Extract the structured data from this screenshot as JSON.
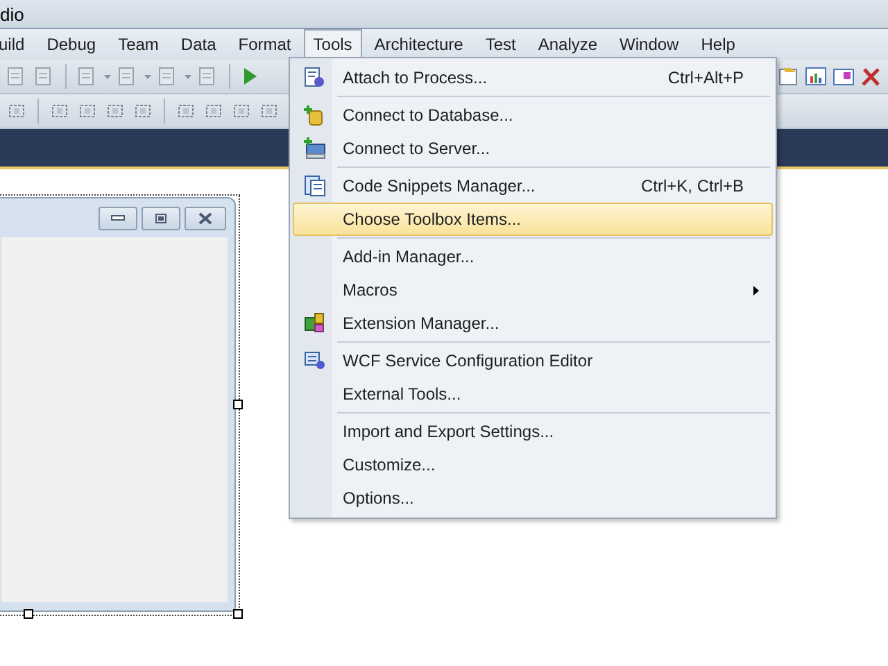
{
  "window": {
    "title": "dio"
  },
  "menu_bar": [
    {
      "label": "uild",
      "selected": false
    },
    {
      "label": "Debug",
      "selected": false
    },
    {
      "label": "Team",
      "selected": false
    },
    {
      "label": "Data",
      "selected": false
    },
    {
      "label": "Format",
      "selected": false
    },
    {
      "label": "Tools",
      "selected": true
    },
    {
      "label": "Architecture",
      "selected": false
    },
    {
      "label": "Test",
      "selected": false
    },
    {
      "label": "Analyze",
      "selected": false
    },
    {
      "label": "Window",
      "selected": false
    },
    {
      "label": "Help",
      "selected": false
    }
  ],
  "tools_menu": [
    {
      "kind": "item",
      "label": "Attach to Process...",
      "shortcut": "Ctrl+Alt+P",
      "icon": true,
      "selected": false
    },
    {
      "kind": "separator"
    },
    {
      "kind": "item",
      "label": "Connect to Database...",
      "icon": true,
      "selected": false
    },
    {
      "kind": "item",
      "label": "Connect to Server...",
      "icon": true,
      "selected": false
    },
    {
      "kind": "separator"
    },
    {
      "kind": "item",
      "label": "Code Snippets Manager...",
      "shortcut": "Ctrl+K, Ctrl+B",
      "icon": true,
      "selected": false
    },
    {
      "kind": "item",
      "label": "Choose Toolbox Items...",
      "selected": true
    },
    {
      "kind": "separator"
    },
    {
      "kind": "item",
      "label": "Add-in Manager...",
      "selected": false
    },
    {
      "kind": "item",
      "label": "Macros",
      "submenu": true,
      "selected": false
    },
    {
      "kind": "item",
      "label": "Extension Manager...",
      "icon": true,
      "selected": false
    },
    {
      "kind": "separator"
    },
    {
      "kind": "item",
      "label": "WCF Service Configuration Editor",
      "icon": true,
      "selected": false
    },
    {
      "kind": "item",
      "label": "External Tools...",
      "selected": false
    },
    {
      "kind": "separator"
    },
    {
      "kind": "item",
      "label": "Import and Export Settings...",
      "selected": false
    },
    {
      "kind": "item",
      "label": "Customize...",
      "selected": false
    },
    {
      "kind": "item",
      "label": "Options...",
      "selected": false
    }
  ]
}
